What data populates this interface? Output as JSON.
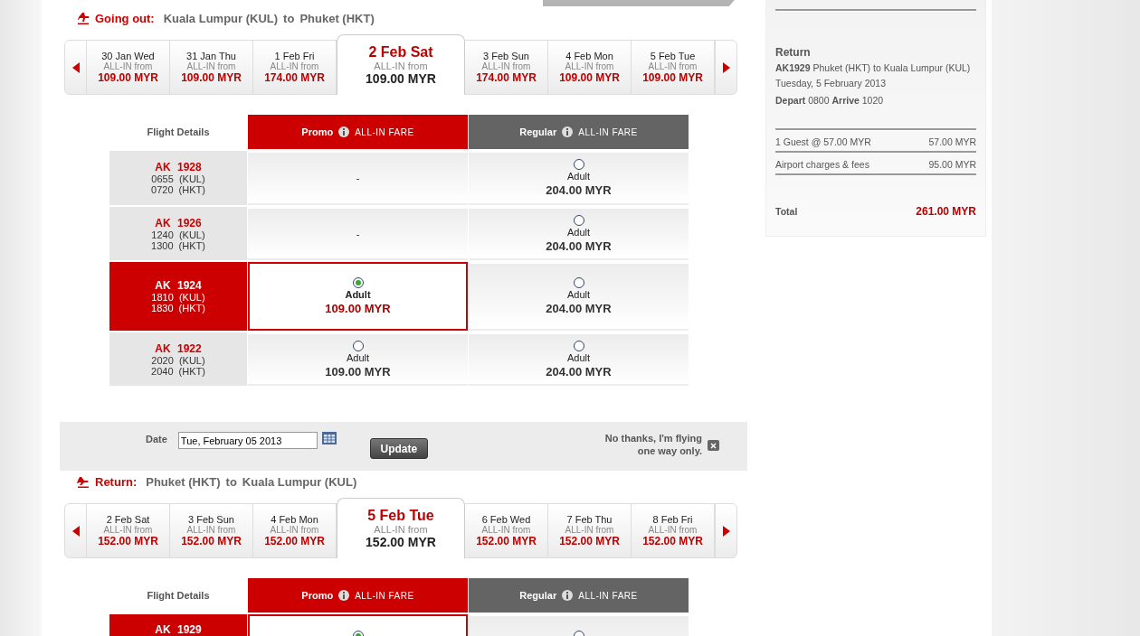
{
  "outbound": {
    "kind": "depart",
    "label": "Going out:",
    "origin": "Kuala Lumpur (KUL)",
    "joiner": "to",
    "destination": "Phuket (HKT)",
    "dates": [
      {
        "day": "30 Jan Wed",
        "note": "ALL-IN from",
        "price": "109.00 MYR",
        "selected": false
      },
      {
        "day": "31 Jan Thu",
        "note": "ALL-IN from",
        "price": "109.00 MYR",
        "selected": false
      },
      {
        "day": "1 Feb Fri",
        "note": "ALL-IN from",
        "price": "174.00 MYR",
        "selected": false
      },
      {
        "day": "2 Feb Sat",
        "note": "ALL-IN from",
        "price": "109.00 MYR",
        "selected": true
      },
      {
        "day": "3 Feb Sun",
        "note": "ALL-IN from",
        "price": "174.00 MYR",
        "selected": false
      },
      {
        "day": "4 Feb Mon",
        "note": "ALL-IN from",
        "price": "109.00 MYR",
        "selected": false
      },
      {
        "day": "5 Feb Tue",
        "note": "ALL-IN from",
        "price": "109.00 MYR",
        "selected": false
      }
    ],
    "table": {
      "details_heading": "Flight Details",
      "fare_columns": [
        {
          "kind": "promo",
          "name": "Promo",
          "note": "ALL-IN FARE"
        },
        {
          "kind": "regular",
          "name": "Regular",
          "note": "ALL-IN FARE"
        }
      ],
      "rows": [
        {
          "flight": "AK 1928",
          "depart": "0655 (KUL)",
          "arrive": "0720 (HKT)",
          "selected": false,
          "fares": [
            {
              "kind": "none",
              "text": "-"
            },
            {
              "kind": "fare",
              "selected": false,
              "type": "Adult",
              "price": "204.00 MYR"
            }
          ]
        },
        {
          "flight": "AK 1926",
          "depart": "1240 (KUL)",
          "arrive": "1300 (HKT)",
          "selected": false,
          "fares": [
            {
              "kind": "none",
              "text": "-"
            },
            {
              "kind": "fare",
              "selected": false,
              "type": "Adult",
              "price": "204.00 MYR"
            }
          ]
        },
        {
          "flight": "AK 1924",
          "depart": "1810 (KUL)",
          "arrive": "1830 (HKT)",
          "selected": true,
          "fares": [
            {
              "kind": "fare",
              "selected": true,
              "type": "Adult",
              "price": "109.00 MYR"
            },
            {
              "kind": "fare",
              "selected": false,
              "type": "Adult",
              "price": "204.00 MYR"
            }
          ]
        },
        {
          "flight": "AK 1922",
          "depart": "2020 (KUL)",
          "arrive": "2040 (HKT)",
          "selected": false,
          "fares": [
            {
              "kind": "fare",
              "selected": false,
              "type": "Adult",
              "price": "109.00 MYR"
            },
            {
              "kind": "fare",
              "selected": false,
              "type": "Adult",
              "price": "204.00 MYR"
            }
          ]
        }
      ]
    }
  },
  "return_date": {
    "label": "Date",
    "value": "Tue, February 05 2013",
    "button": "Update",
    "one_way": "No thanks, I'm flying one way only."
  },
  "return": {
    "kind": "return",
    "label": "Return:",
    "origin": "Phuket (HKT)",
    "joiner": "to",
    "destination": "Kuala Lumpur (KUL)",
    "dates": [
      {
        "day": "2 Feb Sat",
        "note": "ALL-IN from",
        "price": "152.00 MYR",
        "selected": false
      },
      {
        "day": "3 Feb Sun",
        "note": "ALL-IN from",
        "price": "152.00 MYR",
        "selected": false
      },
      {
        "day": "4 Feb Mon",
        "note": "ALL-IN from",
        "price": "152.00 MYR",
        "selected": false
      },
      {
        "day": "5 Feb Tue",
        "note": "ALL-IN from",
        "price": "152.00 MYR",
        "selected": true
      },
      {
        "day": "6 Feb Wed",
        "note": "ALL-IN from",
        "price": "152.00 MYR",
        "selected": false
      },
      {
        "day": "7 Feb Thu",
        "note": "ALL-IN from",
        "price": "152.00 MYR",
        "selected": false
      },
      {
        "day": "8 Feb Fri",
        "note": "ALL-IN from",
        "price": "152.00 MYR",
        "selected": false
      }
    ],
    "table": {
      "details_heading": "Flight Details",
      "fare_columns": [
        {
          "kind": "promo",
          "name": "Promo",
          "note": "ALL-IN FARE"
        },
        {
          "kind": "regular",
          "name": "Regular",
          "note": "ALL-IN FARE"
        }
      ],
      "rows": [
        {
          "flight": "AK 1929",
          "selected": true,
          "fares": [
            {
              "kind": "fare",
              "selected": true
            },
            {
              "kind": "fare",
              "selected": false
            }
          ]
        }
      ]
    }
  },
  "summary": {
    "heading": "Return",
    "flight": "AK1929",
    "route": "Phuket (HKT) to Kuala Lumpur (KUL)",
    "date": "Tuesday, 5 February 2013",
    "depart_label": "Depart",
    "depart": "0800",
    "arrive_label": "Arrive",
    "arrive": "1020",
    "charges": [
      {
        "label": "1 Guest @ 57.00 MYR",
        "amount": "57.00 MYR"
      },
      {
        "label": "Airport charges & fees",
        "amount": "95.00 MYR"
      }
    ],
    "total_label": "Total",
    "total": "261.00 MYR"
  }
}
